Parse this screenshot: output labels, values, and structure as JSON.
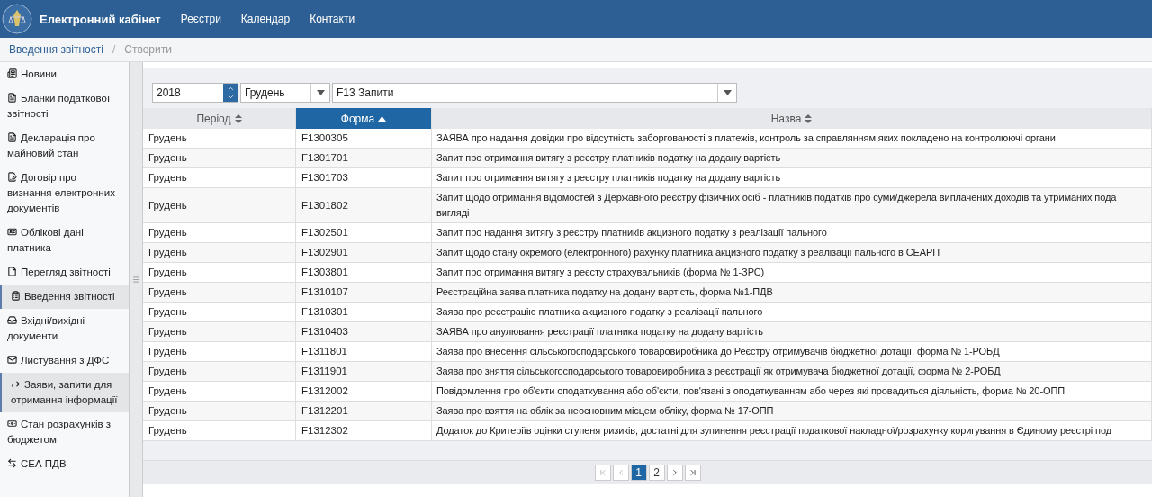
{
  "header": {
    "title": "Електронний кабінет",
    "nav": [
      {
        "label": "Реєстри"
      },
      {
        "label": "Календар"
      },
      {
        "label": "Контакти"
      }
    ]
  },
  "breadcrumb": {
    "items": [
      {
        "label": "Введення звітності"
      },
      {
        "label": "Створити"
      }
    ],
    "separator": "/"
  },
  "sidebar": {
    "items": [
      {
        "label": "Новини",
        "selected": false
      },
      {
        "label": "Бланки податкової звітності",
        "selected": false
      },
      {
        "label": "Декларація про майновий стан",
        "selected": false
      },
      {
        "label": "Договір про визнання електронних документів",
        "selected": false
      },
      {
        "label": "Облікові дані платника",
        "selected": false
      },
      {
        "label": "Перегляд звітності",
        "selected": false
      },
      {
        "label": "Введення звітності",
        "selected": true
      },
      {
        "label": "Вхідні/вихідні документи",
        "selected": false
      },
      {
        "label": "Листування з ДФС",
        "selected": false
      },
      {
        "label": "Заяви, запити для отримання інформації",
        "selected": true
      },
      {
        "label": "Стан розрахунків з бюджетом",
        "selected": false
      },
      {
        "label": "СЕА ПДВ",
        "selected": false
      }
    ]
  },
  "filters": {
    "year": "2018",
    "month": "Грудень",
    "group": "F13 Запити"
  },
  "table": {
    "columns": [
      {
        "label": "Період",
        "sorted": false
      },
      {
        "label": "Форма",
        "sorted": true
      },
      {
        "label": "Назва",
        "sorted": false
      }
    ],
    "rows": [
      {
        "period": "Грудень",
        "form": "F1300305",
        "name": "ЗАЯВА про надання довідки про відсутність заборгованості з платежів, контроль за справлянням яких покладено на контролюючі органи"
      },
      {
        "period": "Грудень",
        "form": "F1301701",
        "name": "Запит про отримання витягу з реєстру платників податку на додану вартість"
      },
      {
        "period": "Грудень",
        "form": "F1301703",
        "name": "Запит про отримання витягу з реєстру платників податку на додану вартість"
      },
      {
        "period": "Грудень",
        "form": "F1301802",
        "name": "Запит щодо отримання відомостей з Державного реєстру фізичних осіб - платників податків про суми/джерела виплачених доходів та утриманих пода\nвигляді"
      },
      {
        "period": "Грудень",
        "form": "F1302501",
        "name": "Запит про надання витягу з реєстру платників акцизного податку з реалізації пального"
      },
      {
        "period": "Грудень",
        "form": "F1302901",
        "name": "Запит щодо стану окремого (електронного) рахунку платника акцизного податку з реалізації пального в СЕАРП"
      },
      {
        "period": "Грудень",
        "form": "F1303801",
        "name": "Запит про отримання витягу з реєсту страхувальників (форма № 1-ЗРС)"
      },
      {
        "period": "Грудень",
        "form": "F1310107",
        "name": "Реєстраційна заява платника податку на додану вартість, форма №1-ПДВ"
      },
      {
        "period": "Грудень",
        "form": "F1310301",
        "name": "Заява про реєстрацію платника акцизного податку з реалізації пального"
      },
      {
        "period": "Грудень",
        "form": "F1310403",
        "name": "ЗАЯВА про анулювання реєстрації платника податку на додану вартість"
      },
      {
        "period": "Грудень",
        "form": "F1311801",
        "name": "Заява про внесення сільськогосподарського товаровиробника до Реєстру отримувачів бюджетної дотації, форма № 1-РОБД"
      },
      {
        "period": "Грудень",
        "form": "F1311901",
        "name": "Заява про зняття сільськогосподарського товаровиробника з реєстрації як отримувача бюджетної дотації, форма № 2-РОБД"
      },
      {
        "period": "Грудень",
        "form": "F1312002",
        "name": "Повідомлення про об'єкти оподаткування або об'єкти, пов'язані з оподаткуванням або через які провадиться діяльність, форма № 20-ОПП"
      },
      {
        "period": "Грудень",
        "form": "F1312201",
        "name": "Заява про взяття на облік за неосновним місцем обліку, форма № 17-ОПП"
      },
      {
        "period": "Грудень",
        "form": "F1312302",
        "name": "Додаток до Критеріїв оцінки ступеня ризиків, достатні для зупинення реєстрації податкової накладної/розрахунку коригування в Єдиному реєстрі под"
      }
    ]
  },
  "pagination": {
    "pages": [
      {
        "label": "1",
        "selected": true
      },
      {
        "label": "2",
        "selected": false
      }
    ]
  }
}
